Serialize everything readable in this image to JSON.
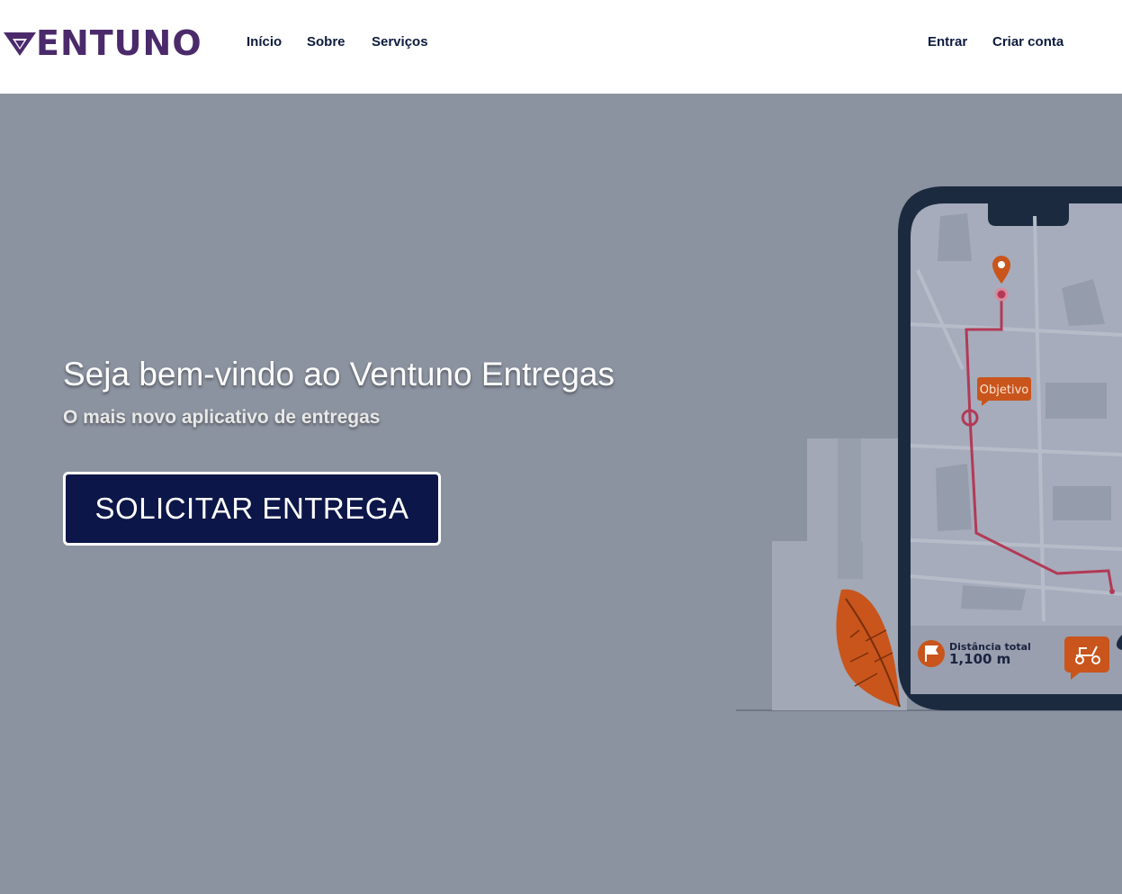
{
  "brand": {
    "name": "ENTUNO",
    "colors": {
      "primary": "#4b2a6b",
      "nav": "#0d1b3e",
      "cta": "#0c1648",
      "accent": "#c9551c",
      "route": "#b23a56"
    }
  },
  "nav": {
    "inicio": "Início",
    "sobre": "Sobre",
    "servicos": "Serviços",
    "entrar": "Entrar",
    "criar_conta": "Criar conta"
  },
  "hero": {
    "title": "Seja bem-vindo ao Ventuno Entregas",
    "subtitle": "O mais novo aplicativo de entregas",
    "cta_label": "SOLICITAR ENTREGA"
  },
  "phone": {
    "objective_label": "Objetivo",
    "distance_label": "Distância total",
    "distance_value": "1,100 m",
    "icons": [
      "location-pin-icon",
      "flag-icon",
      "scooter-icon"
    ]
  }
}
